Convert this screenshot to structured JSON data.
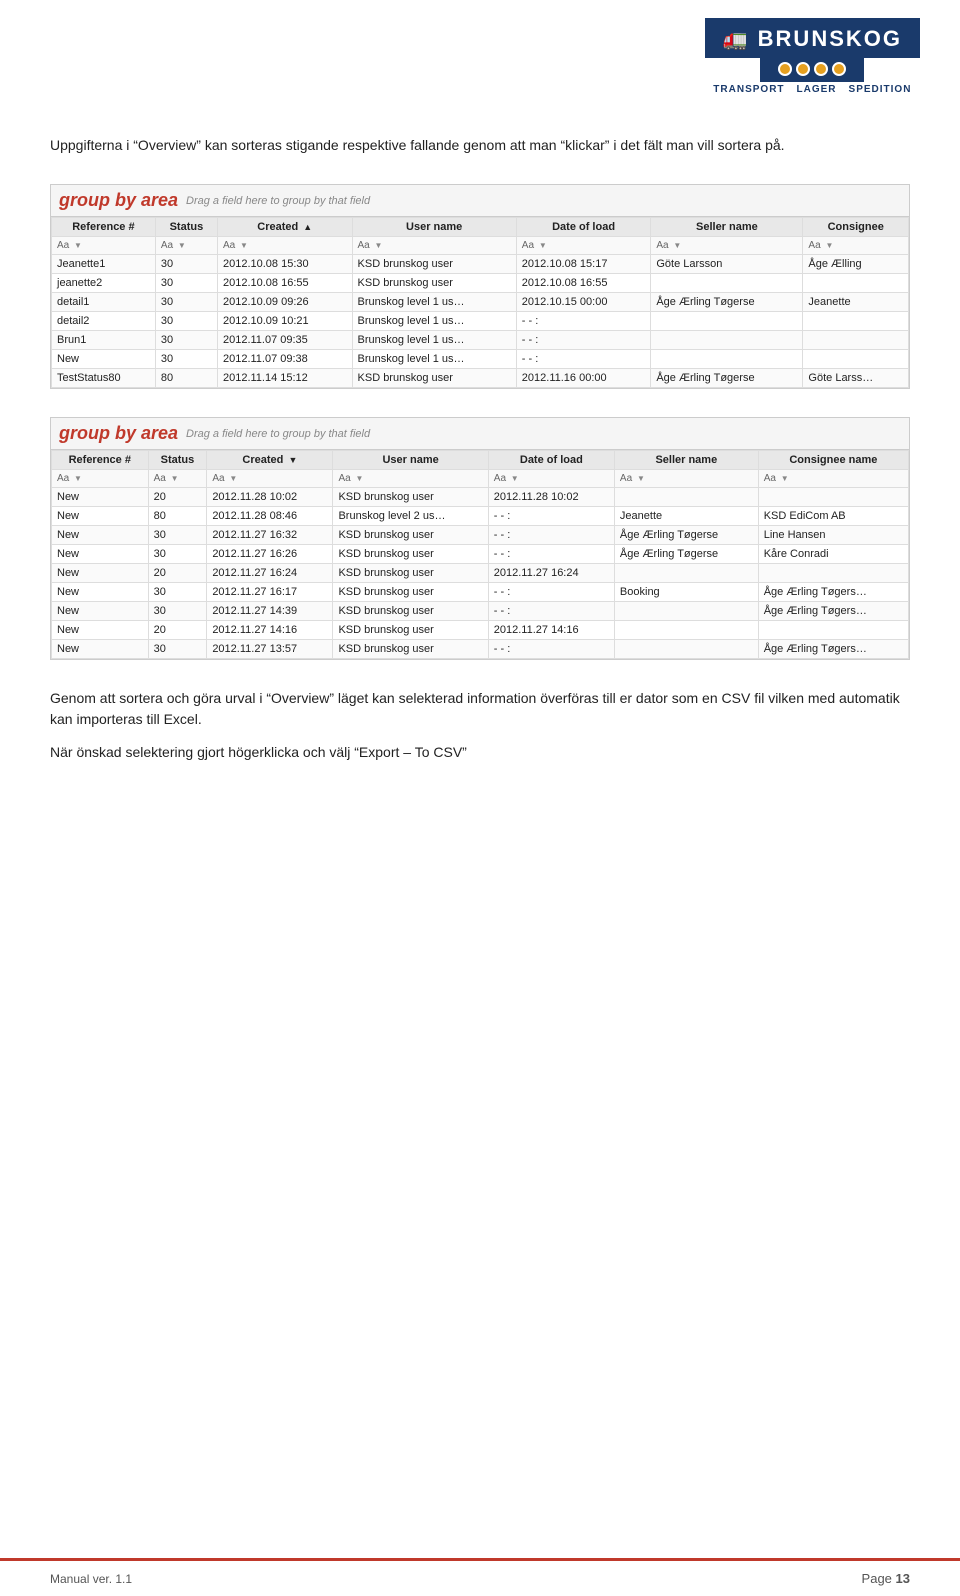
{
  "header": {
    "logo_text": "BRUNSKOG",
    "logo_tagline": [
      "TRANSPORT",
      "LAGER",
      "SPEDITION"
    ]
  },
  "intro_text": "Uppgifterna i “Overview” kan sorteras stigande respektive fallande genom att man “klickar” i det fält man vill sortera på.",
  "grid1": {
    "group_by_label": "group by area",
    "group_by_hint": "Drag a field here to group by that field",
    "columns": [
      "Reference #",
      "Status",
      "Created",
      "User name",
      "Date of load",
      "Seller name",
      "Consignee"
    ],
    "sort_column": "Created",
    "filter_row": [
      "Aa",
      "Aa",
      "Aa",
      "Aa",
      "Aa",
      "Aa",
      "Aa"
    ],
    "rows": [
      [
        "Jeanette1",
        "30",
        "2012.10.08 15:30",
        "KSD brunskog user",
        "2012.10.08 15:17",
        "Göte Larsson",
        "Åge Ælling"
      ],
      [
        "jeanette2",
        "30",
        "2012.10.08 16:55",
        "KSD brunskog user",
        "2012.10.08 16:55",
        "",
        ""
      ],
      [
        "detail1",
        "30",
        "2012.10.09 09:26",
        "Brunskog level 1 us…",
        "2012.10.15 00:00",
        "Åge Ærling Tøgerse",
        "Jeanette"
      ],
      [
        "detail2",
        "30",
        "2012.10.09 10:21",
        "Brunskog level 1 us…",
        "- - :",
        "",
        ""
      ],
      [
        "Brun1",
        "30",
        "2012.11.07 09:35",
        "Brunskog level 1 us…",
        "- - :",
        "",
        ""
      ],
      [
        "New",
        "30",
        "2012.11.07 09:38",
        "Brunskog level 1 us…",
        "- - :",
        "",
        ""
      ],
      [
        "TestStatus80",
        "80",
        "2012.11.14 15:12",
        "KSD brunskog user",
        "2012.11.16 00:00",
        "Åge Ærling Tøgerse",
        "Göte Larss…"
      ]
    ]
  },
  "grid2": {
    "group_by_label": "group by area",
    "group_by_hint": "Drag a field here to group by that field",
    "columns": [
      "Reference #",
      "Status",
      "Created",
      "User name",
      "Date of load",
      "Seller name",
      "Consignee name"
    ],
    "sort_column": "Created",
    "filter_row": [
      "Aa",
      "Aa",
      "Aa",
      "Aa",
      "Aa",
      "Aa",
      "Aa"
    ],
    "rows": [
      [
        "New",
        "20",
        "2012.11.28 10:02",
        "KSD brunskog user",
        "2012.11.28 10:02",
        "",
        ""
      ],
      [
        "New",
        "80",
        "2012.11.28 08:46",
        "Brunskog level 2 us…",
        "- - :",
        "Jeanette",
        "KSD EdiCom AB"
      ],
      [
        "New",
        "30",
        "2012.11.27 16:32",
        "KSD brunskog user",
        "- - :",
        "Åge Ærling Tøgerse",
        "Line Hansen"
      ],
      [
        "New",
        "30",
        "2012.11.27 16:26",
        "KSD brunskog user",
        "- - :",
        "Åge Ærling Tøgerse",
        "Kåre Conradi"
      ],
      [
        "New",
        "20",
        "2012.11.27 16:24",
        "KSD brunskog user",
        "2012.11.27 16:24",
        "",
        ""
      ],
      [
        "New",
        "30",
        "2012.11.27 16:17",
        "KSD brunskog user",
        "- - :",
        "Booking",
        "Åge Ærling Tøgers…"
      ],
      [
        "New",
        "30",
        "2012.11.27 14:39",
        "KSD brunskog user",
        "- - :",
        "",
        "Åge Ærling Tøgers…"
      ],
      [
        "New",
        "20",
        "2012.11.27 14:16",
        "KSD brunskog user",
        "2012.11.27 14:16",
        "",
        ""
      ],
      [
        "New",
        "30",
        "2012.11.27 13:57",
        "KSD brunskog user",
        "- - :",
        "",
        "Åge Ærling Tøgers…"
      ]
    ]
  },
  "body_para1": "Genom att sortera och göra urval i “Overview” läget kan selekterad information överföras till er dator som en CSV fil vilken med automatik kan importeras till Excel.",
  "body_para2": "När önskad selektering gjort högerklicka och välj “Export – To CSV”",
  "footer": {
    "left": "Manual ver. 1.1",
    "right_label": "Page",
    "right_number": "13"
  }
}
